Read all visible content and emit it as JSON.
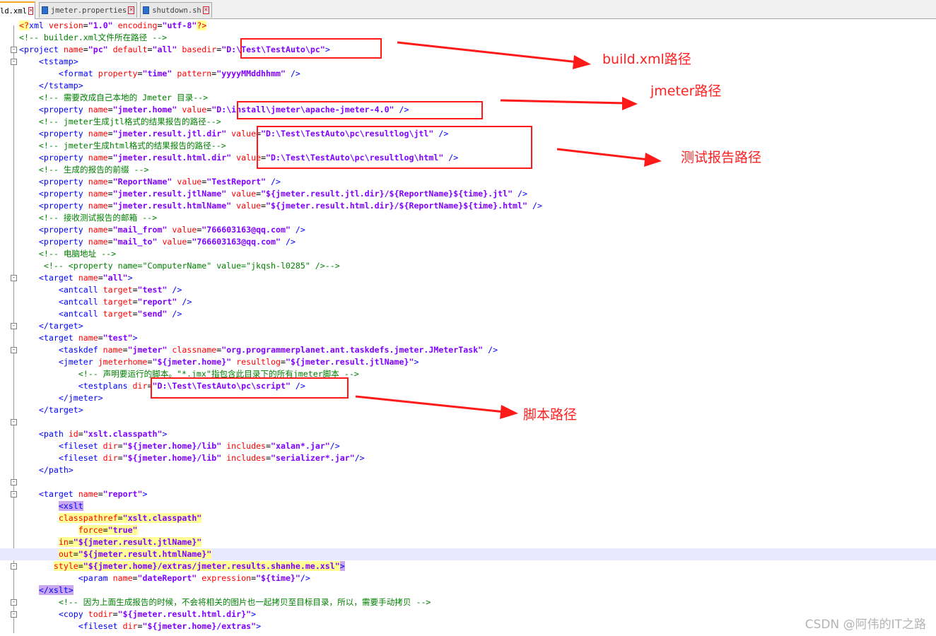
{
  "tabs": [
    {
      "label": "ld.xml",
      "active": true
    },
    {
      "label": "jmeter.properties",
      "active": false
    },
    {
      "label": "shutdown.sh",
      "active": false
    }
  ],
  "code_lines": [
    [
      {
        "t": "p",
        "s": "",
        "h": "hy"
      },
      {
        "t": "a",
        "s": "<?",
        "h": "hy"
      },
      {
        "t": "t",
        "s": "xml ",
        "h": ""
      },
      {
        "t": "a",
        "s": "version",
        "h": ""
      },
      {
        "t": "p",
        "s": "=",
        "h": ""
      },
      {
        "t": "v",
        "s": "\"1.0\"",
        "h": ""
      },
      {
        "t": "a",
        "s": " encoding",
        "h": ""
      },
      {
        "t": "p",
        "s": "=",
        "h": ""
      },
      {
        "t": "v",
        "s": "\"utf-8\"",
        "h": ""
      },
      {
        "t": "a",
        "s": "?>",
        "h": "hy"
      }
    ],
    [
      {
        "t": "c",
        "s": "<!-- builder.xml文件所在路径 -->"
      }
    ],
    [
      {
        "t": "t",
        "s": "<project "
      },
      {
        "t": "a",
        "s": "name"
      },
      {
        "t": "p",
        "s": "="
      },
      {
        "t": "v",
        "s": "\"pc\""
      },
      {
        "t": "a",
        "s": " default"
      },
      {
        "t": "p",
        "s": "="
      },
      {
        "t": "v",
        "s": "\"all\""
      },
      {
        "t": "a",
        "s": " basedir"
      },
      {
        "t": "p",
        "s": "="
      },
      {
        "t": "v",
        "s": "\"D:\\Test\\TestAuto\\pc\""
      },
      {
        "t": "t",
        "s": ">"
      }
    ],
    [
      {
        "t": "t",
        "s": "    <tstamp>"
      }
    ],
    [
      {
        "t": "t",
        "s": "        <format "
      },
      {
        "t": "a",
        "s": "property"
      },
      {
        "t": "p",
        "s": "="
      },
      {
        "t": "v",
        "s": "\"time\""
      },
      {
        "t": "a",
        "s": " pattern"
      },
      {
        "t": "p",
        "s": "="
      },
      {
        "t": "v",
        "s": "\"yyyyMMddhhmm\""
      },
      {
        "t": "t",
        "s": " />"
      }
    ],
    [
      {
        "t": "t",
        "s": "    </tstamp>"
      }
    ],
    [
      {
        "t": "c",
        "s": "    <!-- 需要改成自己本地的 Jmeter 目录-->"
      }
    ],
    [
      {
        "t": "t",
        "s": "    <property "
      },
      {
        "t": "a",
        "s": "name"
      },
      {
        "t": "p",
        "s": "="
      },
      {
        "t": "v",
        "s": "\"jmeter.home\""
      },
      {
        "t": "a",
        "s": " value"
      },
      {
        "t": "p",
        "s": "="
      },
      {
        "t": "v",
        "s": "\"D:\\install\\jmeter\\apache-jmeter-4.0\""
      },
      {
        "t": "t",
        "s": " />"
      }
    ],
    [
      {
        "t": "c",
        "s": "    <!-- jmeter生成jtl格式的结果报告的路径-->"
      }
    ],
    [
      {
        "t": "t",
        "s": "    <property "
      },
      {
        "t": "a",
        "s": "name"
      },
      {
        "t": "p",
        "s": "="
      },
      {
        "t": "v",
        "s": "\"jmeter.result.jtl.dir\""
      },
      {
        "t": "a",
        "s": " value"
      },
      {
        "t": "p",
        "s": "="
      },
      {
        "t": "v",
        "s": "\"D:\\Test\\TestAuto\\pc\\resultlog\\jtl\""
      },
      {
        "t": "t",
        "s": " />"
      }
    ],
    [
      {
        "t": "c",
        "s": "    <!-- jmeter生成html格式的结果报告的路径-->"
      }
    ],
    [
      {
        "t": "t",
        "s": "    <property "
      },
      {
        "t": "a",
        "s": "name"
      },
      {
        "t": "p",
        "s": "="
      },
      {
        "t": "v",
        "s": "\"jmeter.result.html.dir\""
      },
      {
        "t": "a",
        "s": " value"
      },
      {
        "t": "p",
        "s": "="
      },
      {
        "t": "v",
        "s": "\"D:\\Test\\TestAuto\\pc\\resultlog\\html\""
      },
      {
        "t": "t",
        "s": " />"
      }
    ],
    [
      {
        "t": "c",
        "s": "    <!-- 生成的报告的前缀 -->"
      }
    ],
    [
      {
        "t": "t",
        "s": "    <property "
      },
      {
        "t": "a",
        "s": "name"
      },
      {
        "t": "p",
        "s": "="
      },
      {
        "t": "v",
        "s": "\"ReportName\""
      },
      {
        "t": "a",
        "s": " value"
      },
      {
        "t": "p",
        "s": "="
      },
      {
        "t": "v",
        "s": "\"TestReport\""
      },
      {
        "t": "t",
        "s": " />"
      }
    ],
    [
      {
        "t": "t",
        "s": "    <property "
      },
      {
        "t": "a",
        "s": "name"
      },
      {
        "t": "p",
        "s": "="
      },
      {
        "t": "v",
        "s": "\"jmeter.result.jtlName\""
      },
      {
        "t": "a",
        "s": " value"
      },
      {
        "t": "p",
        "s": "="
      },
      {
        "t": "v",
        "s": "\"${jmeter.result.jtl.dir}/${ReportName}${time}.jtl\""
      },
      {
        "t": "t",
        "s": " />"
      }
    ],
    [
      {
        "t": "t",
        "s": "    <property "
      },
      {
        "t": "a",
        "s": "name"
      },
      {
        "t": "p",
        "s": "="
      },
      {
        "t": "v",
        "s": "\"jmeter.result.htmlName\""
      },
      {
        "t": "a",
        "s": " value"
      },
      {
        "t": "p",
        "s": "="
      },
      {
        "t": "v",
        "s": "\"${jmeter.result.html.dir}/${ReportName}${time}.html\""
      },
      {
        "t": "t",
        "s": " />"
      }
    ],
    [
      {
        "t": "c",
        "s": "    <!-- 接收测试报告的邮箱 -->"
      }
    ],
    [
      {
        "t": "t",
        "s": "    <property "
      },
      {
        "t": "a",
        "s": "name"
      },
      {
        "t": "p",
        "s": "="
      },
      {
        "t": "v",
        "s": "\"mail_from\""
      },
      {
        "t": "a",
        "s": " value"
      },
      {
        "t": "p",
        "s": "="
      },
      {
        "t": "v",
        "s": "\"766603163@qq.com\""
      },
      {
        "t": "t",
        "s": " />"
      }
    ],
    [
      {
        "t": "t",
        "s": "    <property "
      },
      {
        "t": "a",
        "s": "name"
      },
      {
        "t": "p",
        "s": "="
      },
      {
        "t": "v",
        "s": "\"mail_to\""
      },
      {
        "t": "a",
        "s": " value"
      },
      {
        "t": "p",
        "s": "="
      },
      {
        "t": "v",
        "s": "\"766603163@qq.com\""
      },
      {
        "t": "t",
        "s": " />"
      }
    ],
    [
      {
        "t": "c",
        "s": "    <!-- 电脑地址 -->"
      }
    ],
    [
      {
        "t": "c",
        "s": "     <!-- <property name=\"ComputerName\" value=\"jkqsh-l0285\" />-->"
      }
    ],
    [
      {
        "t": "t",
        "s": "    <target "
      },
      {
        "t": "a",
        "s": "name"
      },
      {
        "t": "p",
        "s": "="
      },
      {
        "t": "v",
        "s": "\"all\""
      },
      {
        "t": "t",
        "s": ">"
      }
    ],
    [
      {
        "t": "t",
        "s": "        <antcall "
      },
      {
        "t": "a",
        "s": "target"
      },
      {
        "t": "p",
        "s": "="
      },
      {
        "t": "v",
        "s": "\"test\""
      },
      {
        "t": "t",
        "s": " />"
      }
    ],
    [
      {
        "t": "t",
        "s": "        <antcall "
      },
      {
        "t": "a",
        "s": "target"
      },
      {
        "t": "p",
        "s": "="
      },
      {
        "t": "v",
        "s": "\"report\""
      },
      {
        "t": "t",
        "s": " />"
      }
    ],
    [
      {
        "t": "t",
        "s": "        <antcall "
      },
      {
        "t": "a",
        "s": "target"
      },
      {
        "t": "p",
        "s": "="
      },
      {
        "t": "v",
        "s": "\"send\""
      },
      {
        "t": "t",
        "s": " />"
      }
    ],
    [
      {
        "t": "t",
        "s": "    </target>"
      }
    ],
    [
      {
        "t": "t",
        "s": "    <target "
      },
      {
        "t": "a",
        "s": "name"
      },
      {
        "t": "p",
        "s": "="
      },
      {
        "t": "v",
        "s": "\"test\""
      },
      {
        "t": "t",
        "s": ">"
      }
    ],
    [
      {
        "t": "t",
        "s": "        <taskdef "
      },
      {
        "t": "a",
        "s": "name"
      },
      {
        "t": "p",
        "s": "="
      },
      {
        "t": "v",
        "s": "\"jmeter\""
      },
      {
        "t": "a",
        "s": " classname"
      },
      {
        "t": "p",
        "s": "="
      },
      {
        "t": "v",
        "s": "\"org.programmerplanet.ant.taskdefs.jmeter.JMeterTask\""
      },
      {
        "t": "t",
        "s": " />"
      }
    ],
    [
      {
        "t": "t",
        "s": "        <jmeter "
      },
      {
        "t": "a",
        "s": "jmeterhome"
      },
      {
        "t": "p",
        "s": "="
      },
      {
        "t": "v",
        "s": "\"${jmeter.home}\""
      },
      {
        "t": "a",
        "s": " resultlog"
      },
      {
        "t": "p",
        "s": "="
      },
      {
        "t": "v",
        "s": "\"${jmeter.result.jtlName}\""
      },
      {
        "t": "t",
        "s": ">"
      }
    ],
    [
      {
        "t": "c",
        "s": "            <!-- 声明要运行的脚本。\"*.jmx\"指包含此目录下的所有jmeter脚本 -->"
      }
    ],
    [
      {
        "t": "t",
        "s": "            <testplans "
      },
      {
        "t": "a",
        "s": "dir"
      },
      {
        "t": "p",
        "s": "="
      },
      {
        "t": "v",
        "s": "\"D:\\Test\\TestAuto\\pc\\script\""
      },
      {
        "t": "t",
        "s": " />"
      }
    ],
    [
      {
        "t": "t",
        "s": "        </jmeter>"
      }
    ],
    [
      {
        "t": "t",
        "s": "    </target>"
      }
    ],
    [],
    [
      {
        "t": "t",
        "s": "    <path "
      },
      {
        "t": "a",
        "s": "id"
      },
      {
        "t": "p",
        "s": "="
      },
      {
        "t": "v",
        "s": "\"xslt.classpath\""
      },
      {
        "t": "t",
        "s": ">"
      }
    ],
    [
      {
        "t": "t",
        "s": "        <fileset "
      },
      {
        "t": "a",
        "s": "dir"
      },
      {
        "t": "p",
        "s": "="
      },
      {
        "t": "v",
        "s": "\"${jmeter.home}/lib\""
      },
      {
        "t": "a",
        "s": " includes"
      },
      {
        "t": "p",
        "s": "="
      },
      {
        "t": "v",
        "s": "\"xalan*.jar\""
      },
      {
        "t": "t",
        "s": "/>"
      }
    ],
    [
      {
        "t": "t",
        "s": "        <fileset "
      },
      {
        "t": "a",
        "s": "dir"
      },
      {
        "t": "p",
        "s": "="
      },
      {
        "t": "v",
        "s": "\"${jmeter.home}/lib\""
      },
      {
        "t": "a",
        "s": " includes"
      },
      {
        "t": "p",
        "s": "="
      },
      {
        "t": "v",
        "s": "\"serializer*.jar\""
      },
      {
        "t": "t",
        "s": "/>"
      }
    ],
    [
      {
        "t": "t",
        "s": "    </path>"
      }
    ],
    [],
    [
      {
        "t": "t",
        "s": "    <target "
      },
      {
        "t": "a",
        "s": "name"
      },
      {
        "t": "p",
        "s": "="
      },
      {
        "t": "v",
        "s": "\"report\""
      },
      {
        "t": "t",
        "s": ">"
      }
    ],
    [
      {
        "t": "p",
        "s": "        "
      },
      {
        "t": "t",
        "s": "<xslt",
        "h": "hp"
      }
    ],
    [
      {
        "t": "p",
        "s": "        "
      },
      {
        "t": "a",
        "s": "classpathref",
        "h": "hy"
      },
      {
        "t": "p",
        "s": "=",
        "h": "hy"
      },
      {
        "t": "v",
        "s": "\"xslt.classpath\"",
        "h": "hy"
      }
    ],
    [
      {
        "t": "p",
        "s": "            "
      },
      {
        "t": "a",
        "s": "force",
        "h": "hy"
      },
      {
        "t": "p",
        "s": "=",
        "h": "hy"
      },
      {
        "t": "v",
        "s": "\"true\"",
        "h": "hy"
      }
    ],
    [
      {
        "t": "p",
        "s": "        "
      },
      {
        "t": "a",
        "s": "in",
        "h": "hy"
      },
      {
        "t": "p",
        "s": "=",
        "h": "hy"
      },
      {
        "t": "v",
        "s": "\"${jmeter.result.jtlName}\"",
        "h": "hy"
      }
    ],
    [
      {
        "t": "p",
        "s": "        "
      },
      {
        "t": "a",
        "s": "out",
        "h": "hy"
      },
      {
        "t": "p",
        "s": "=",
        "h": "hy"
      },
      {
        "t": "v",
        "s": "\"${jmeter.result.htmlName}\"",
        "h": "hy"
      }
    ],
    [
      {
        "t": "p",
        "s": "       "
      },
      {
        "t": "a",
        "s": "style",
        "h": "hy"
      },
      {
        "t": "p",
        "s": "=",
        "h": "hy"
      },
      {
        "t": "v",
        "s": "\"${jmeter.home}/extras/jmeter.results.shanhe.me.xsl\"",
        "h": "hy"
      },
      {
        "t": "t",
        "s": ">",
        "h": "hp"
      }
    ],
    [
      {
        "t": "t",
        "s": "            <param "
      },
      {
        "t": "a",
        "s": "name"
      },
      {
        "t": "p",
        "s": "="
      },
      {
        "t": "v",
        "s": "\"dateReport\""
      },
      {
        "t": "a",
        "s": " expression"
      },
      {
        "t": "p",
        "s": "="
      },
      {
        "t": "v",
        "s": "\"${time}\""
      },
      {
        "t": "t",
        "s": "/>"
      }
    ],
    [
      {
        "t": "p",
        "s": "    "
      },
      {
        "t": "t",
        "s": "</xslt>",
        "h": "hp"
      }
    ],
    [
      {
        "t": "c",
        "s": "        <!-- 因为上面生成报告的时候，不会将相关的图片也一起拷贝至目标目录，所以，需要手动拷贝 -->"
      }
    ],
    [
      {
        "t": "t",
        "s": "        <copy "
      },
      {
        "t": "a",
        "s": "todir"
      },
      {
        "t": "p",
        "s": "="
      },
      {
        "t": "v",
        "s": "\"${jmeter.result.html.dir}\""
      },
      {
        "t": "t",
        "s": ">"
      }
    ],
    [
      {
        "t": "t",
        "s": "            <fileset "
      },
      {
        "t": "a",
        "s": "dir"
      },
      {
        "t": "p",
        "s": "="
      },
      {
        "t": "v",
        "s": "\"${jmeter.home}/extras\""
      },
      {
        "t": "t",
        "s": ">"
      }
    ]
  ],
  "fold_marks": {
    "2": "-",
    "3": "-",
    "21": "-",
    "25": "-",
    "27": "-",
    "33": "-",
    "38": "-",
    "39": "-",
    "45": "-",
    "48": "-",
    "49": "-"
  },
  "highlight_line": 44,
  "annotations": {
    "build": "build.xml路径",
    "jmeter": "jmeter路径",
    "report": "测试报告路径",
    "script": "脚本路径"
  },
  "watermark": "CSDN @阿伟的IT之路",
  "colors": {
    "tag": "#0000ff",
    "attr": "#ff0000",
    "value": "#8000ff",
    "comment": "#008000",
    "annotation": "#ff2020",
    "active_tab_accent": "#f6a82a"
  }
}
